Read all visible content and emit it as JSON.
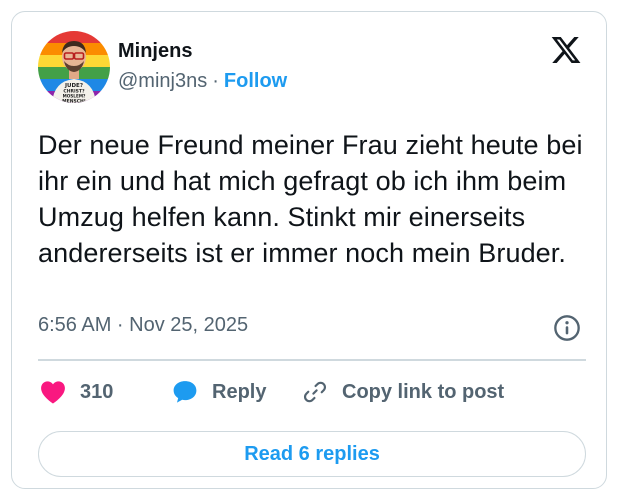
{
  "author": {
    "display_name": "Minjens",
    "handle": "@minj3ns",
    "separator": "·",
    "follow_label": "Follow",
    "avatar_shirt_text": "JUDE? CHRIST? MOSLEM? MENSCH!"
  },
  "tweet": {
    "text": "Der neue Freund meiner Frau zieht heute bei ihr ein und hat mich gefragt ob ich ihm beim Umzug helfen kann. Stinkt mir einerseits andererseits ist er immer noch mein Bruder.",
    "timestamp": "6:56 AM · Nov 25, 2025"
  },
  "actions": {
    "like_count": "310",
    "reply_label": "Reply",
    "copy_link_label": "Copy link to post"
  },
  "read_replies_label": "Read 6 replies",
  "icons": {
    "brand": "x-logo-icon",
    "info": "info-icon",
    "like": "heart-icon",
    "reply": "speech-bubble-icon",
    "copy": "link-icon"
  },
  "colors": {
    "accent": "#1d9bf0",
    "like": "#f91880",
    "text_primary": "#0f1419",
    "text_secondary": "#536471",
    "border": "#cfd9de"
  }
}
